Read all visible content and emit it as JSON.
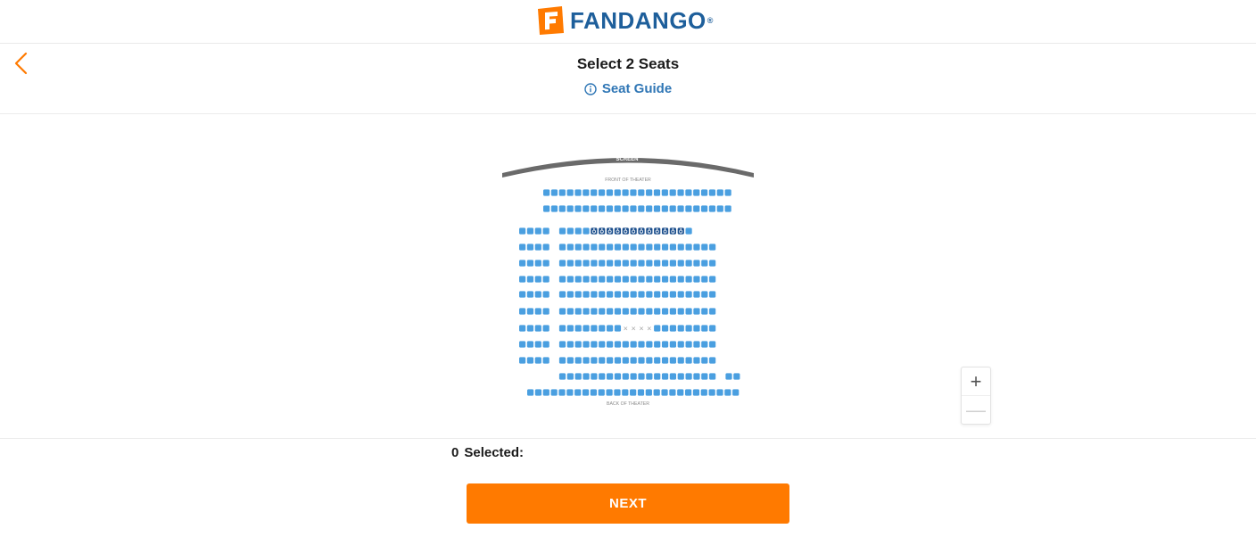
{
  "brand": {
    "name": "FANDANGO",
    "reg": "®",
    "accent": "#ff7a00",
    "blue": "#1e5f9b"
  },
  "header": {
    "back_icon": "chevron-left-icon",
    "title": "Select 2 Seats",
    "seat_guide_label": "Seat Guide",
    "seat_guide_icon": "info-icon"
  },
  "seat_map": {
    "screen_label": "SCREEN",
    "front_label": "FRONT OF THEATER",
    "back_label": "BACK OF THEATER",
    "colors": {
      "available": "#4a9fe0",
      "wheelchair": "#1b4e8c",
      "screen": "#6a6a6a"
    },
    "wheelchair_icon": "wheelchair-icon",
    "unavailable_icon": "x-mark-icon",
    "rows": [
      {
        "groups": [
          {
            "type": "available",
            "count": 24
          }
        ]
      },
      {
        "groups": [
          {
            "type": "available",
            "count": 24
          }
        ]
      },
      {
        "groups": [
          {
            "type": "available",
            "count": 4
          },
          {
            "type": "gap"
          },
          {
            "type": "available",
            "count": 4
          },
          {
            "type": "wheelchair",
            "count": 12
          },
          {
            "type": "available",
            "count": 1
          }
        ]
      },
      {
        "groups": [
          {
            "type": "available",
            "count": 4
          },
          {
            "type": "gap"
          },
          {
            "type": "available",
            "count": 20
          }
        ]
      },
      {
        "groups": [
          {
            "type": "available",
            "count": 4
          },
          {
            "type": "gap"
          },
          {
            "type": "available",
            "count": 20
          }
        ]
      },
      {
        "groups": [
          {
            "type": "available",
            "count": 4
          },
          {
            "type": "gap"
          },
          {
            "type": "available",
            "count": 20
          }
        ]
      },
      {
        "groups": [
          {
            "type": "available",
            "count": 4
          },
          {
            "type": "gap"
          },
          {
            "type": "available",
            "count": 20
          }
        ]
      },
      {
        "groups": [
          {
            "type": "available",
            "count": 4
          },
          {
            "type": "gap"
          },
          {
            "type": "available",
            "count": 20
          }
        ]
      },
      {
        "groups": [
          {
            "type": "available",
            "count": 4
          },
          {
            "type": "gap"
          },
          {
            "type": "available",
            "count": 8
          },
          {
            "type": "unavailable",
            "count": 4
          },
          {
            "type": "available",
            "count": 8
          }
        ]
      },
      {
        "groups": [
          {
            "type": "available",
            "count": 4
          },
          {
            "type": "gap"
          },
          {
            "type": "available",
            "count": 20
          }
        ]
      },
      {
        "groups": [
          {
            "type": "available",
            "count": 4
          },
          {
            "type": "gap"
          },
          {
            "type": "available",
            "count": 20
          }
        ]
      },
      {
        "groups": [
          {
            "type": "spacer",
            "count": 4
          },
          {
            "type": "gap"
          },
          {
            "type": "available",
            "count": 20
          },
          {
            "type": "gap"
          },
          {
            "type": "available",
            "count": 2
          }
        ]
      },
      {
        "groups": [
          {
            "type": "available",
            "count": 27
          }
        ]
      }
    ]
  },
  "zoom": {
    "in_label": "+",
    "out_label": "—",
    "in_icon": "plus-icon",
    "out_icon": "minus-icon"
  },
  "selection": {
    "count": "0",
    "label": "Selected:"
  },
  "next_button": {
    "label": "NEXT"
  }
}
